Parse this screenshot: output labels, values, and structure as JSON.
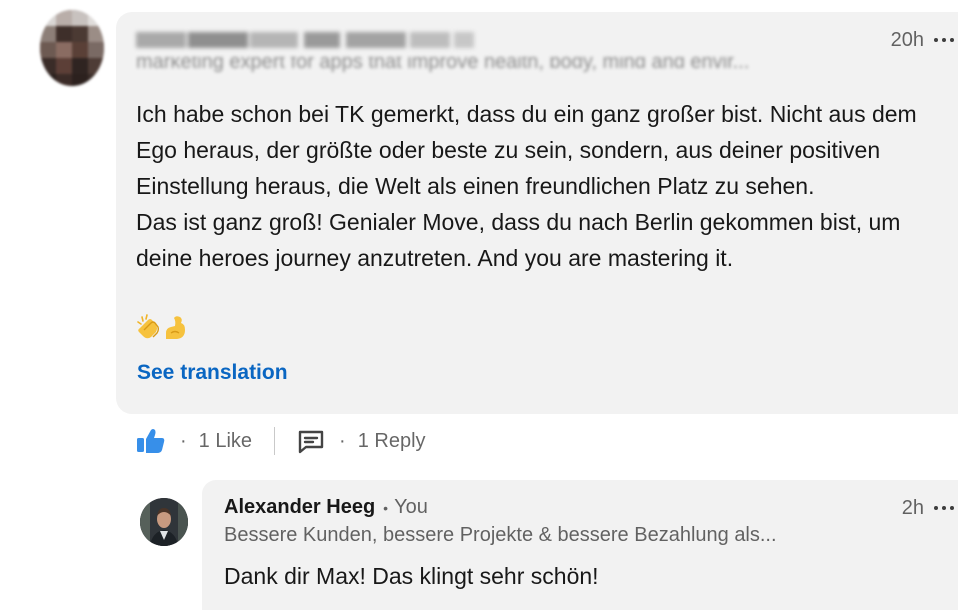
{
  "comment": {
    "author_name": "",
    "time": "20h",
    "body_paragraphs": [
      "Ich habe schon bei TK gemerkt, dass du ein ganz großer bist. Nicht aus dem Ego heraus, der größte oder beste zu sein, sondern, aus deiner positiven Einstellung heraus, die Welt als einen freundlichen Platz zu sehen.",
      "Das ist ganz groß! Genialer Move, dass du nach Berlin gekommen bist, um deine heroes journey anzutreten. And you are mastering it."
    ],
    "emoji": [
      "👏",
      "💪"
    ],
    "translation_link": "See translation",
    "like_count": "1 Like",
    "reply_count": "1 Reply",
    "separator": "·"
  },
  "reply": {
    "author_name": "Alexander Heeg",
    "bullet": "•",
    "relation": "You",
    "time": "2h",
    "headline": "Bessere Kunden, bessere Projekte & bessere Bezahlung als...",
    "body": "Dank dir Max! Das klingt sehr schön!"
  },
  "icons": {
    "like": "thumbs-up-icon",
    "reply": "comment-icon",
    "more": "more-icon"
  },
  "colors": {
    "bubble": "#f2f2f2",
    "link": "#0a66c2",
    "like": "#378fe9"
  }
}
